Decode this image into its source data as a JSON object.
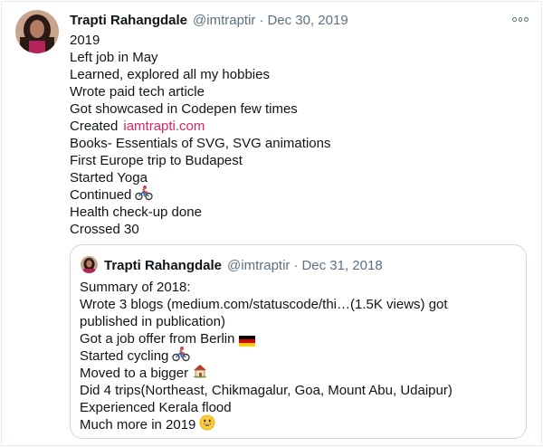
{
  "tweet": {
    "author_name": "Trapti Rahangdale",
    "handle": "@imtraptir",
    "separator": "·",
    "date": "Dec 30, 2019",
    "lines": [
      "2019",
      "Left job in May",
      "Learned, explored all my hobbies",
      "Wrote paid tech article",
      "Got showcased in Codepen few times",
      "Created",
      "Books- Essentials of SVG, SVG animations",
      "First Europe trip to Budapest",
      "Started Yoga",
      "Continued",
      "Health check-up done",
      "Crossed 30"
    ],
    "link": "iamtrapti.com",
    "more_icon": "more-horizontal-icon"
  },
  "quote": {
    "author_name": "Trapti Rahangdale",
    "handle": "@imtraptir",
    "separator": "·",
    "date": "Dec 31, 2018",
    "lines": [
      "Summary of 2018:",
      "Wrote 3 blogs (medium.com/statuscode/thi…(1.5K views) got",
      "published in publication)",
      "Got a job offer from Berlin",
      "Started cycling",
      "Moved to a bigger",
      "Did 4 trips(Northeast, Chikmagalur, Goa, Mount Abu, Udaipur)",
      "Experienced Kerala flood",
      "Much more in 2019"
    ]
  },
  "colors": {
    "text": "#0f1419",
    "secondary": "#5b7083",
    "link": "#e0245e",
    "border": "#cfd9de"
  },
  "icons": [
    "cyclist-emoji",
    "germany-flag-emoji",
    "house-emoji",
    "grinning-face-emoji"
  ]
}
